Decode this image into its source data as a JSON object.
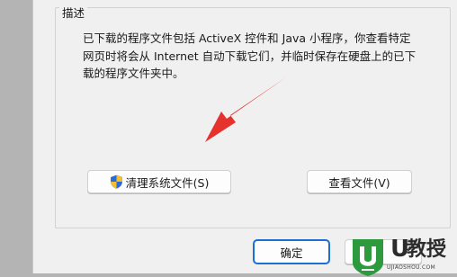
{
  "group": {
    "title": "描述",
    "description": "已下载的程序文件包括 ActiveX 控件和 Java 小程序，你查看特定网页时将会从 Internet 自动下载它们，并临时保存在硬盘上的已下载的程序文件夹中。"
  },
  "buttons": {
    "clean_label": "清理系统文件(S)",
    "view_label": "查看文件(V)",
    "ok_label": "确定"
  },
  "watermark": {
    "logo_text": "U",
    "brand_text": "教授",
    "site_text": "UJIAOSHOU.COM"
  },
  "icons": {
    "shield": "uac-shield-icon",
    "arrow": "red-arrow"
  },
  "colors": {
    "arrow": "#e5322d",
    "watermark_green": "#2d9a3e",
    "ok_border": "#1d6fd0"
  }
}
